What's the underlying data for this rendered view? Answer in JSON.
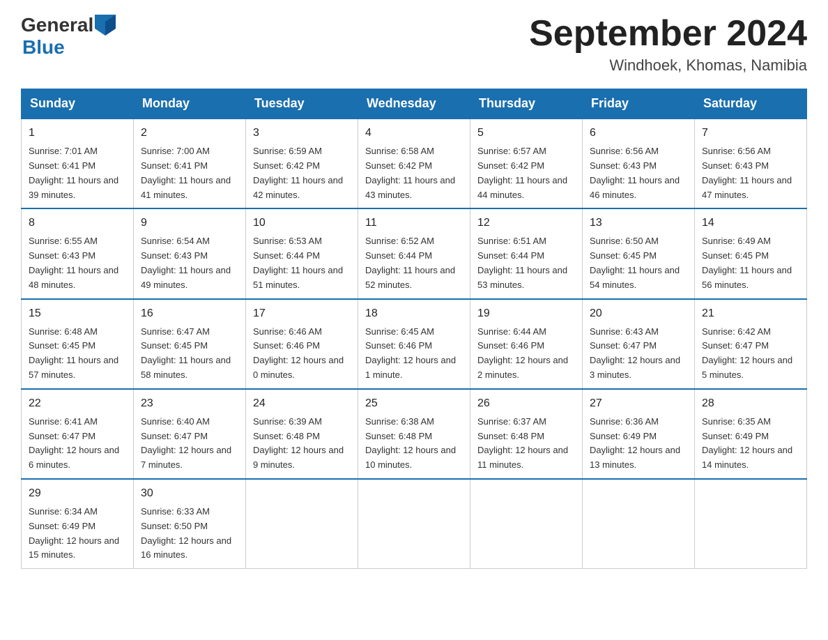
{
  "header": {
    "logo": {
      "general": "General",
      "blue": "Blue"
    },
    "title": "September 2024",
    "location": "Windhoek, Khomas, Namibia"
  },
  "days_of_week": [
    "Sunday",
    "Monday",
    "Tuesday",
    "Wednesday",
    "Thursday",
    "Friday",
    "Saturday"
  ],
  "weeks": [
    [
      {
        "day": "1",
        "sunrise": "Sunrise: 7:01 AM",
        "sunset": "Sunset: 6:41 PM",
        "daylight": "Daylight: 11 hours and 39 minutes."
      },
      {
        "day": "2",
        "sunrise": "Sunrise: 7:00 AM",
        "sunset": "Sunset: 6:41 PM",
        "daylight": "Daylight: 11 hours and 41 minutes."
      },
      {
        "day": "3",
        "sunrise": "Sunrise: 6:59 AM",
        "sunset": "Sunset: 6:42 PM",
        "daylight": "Daylight: 11 hours and 42 minutes."
      },
      {
        "day": "4",
        "sunrise": "Sunrise: 6:58 AM",
        "sunset": "Sunset: 6:42 PM",
        "daylight": "Daylight: 11 hours and 43 minutes."
      },
      {
        "day": "5",
        "sunrise": "Sunrise: 6:57 AM",
        "sunset": "Sunset: 6:42 PM",
        "daylight": "Daylight: 11 hours and 44 minutes."
      },
      {
        "day": "6",
        "sunrise": "Sunrise: 6:56 AM",
        "sunset": "Sunset: 6:43 PM",
        "daylight": "Daylight: 11 hours and 46 minutes."
      },
      {
        "day": "7",
        "sunrise": "Sunrise: 6:56 AM",
        "sunset": "Sunset: 6:43 PM",
        "daylight": "Daylight: 11 hours and 47 minutes."
      }
    ],
    [
      {
        "day": "8",
        "sunrise": "Sunrise: 6:55 AM",
        "sunset": "Sunset: 6:43 PM",
        "daylight": "Daylight: 11 hours and 48 minutes."
      },
      {
        "day": "9",
        "sunrise": "Sunrise: 6:54 AM",
        "sunset": "Sunset: 6:43 PM",
        "daylight": "Daylight: 11 hours and 49 minutes."
      },
      {
        "day": "10",
        "sunrise": "Sunrise: 6:53 AM",
        "sunset": "Sunset: 6:44 PM",
        "daylight": "Daylight: 11 hours and 51 minutes."
      },
      {
        "day": "11",
        "sunrise": "Sunrise: 6:52 AM",
        "sunset": "Sunset: 6:44 PM",
        "daylight": "Daylight: 11 hours and 52 minutes."
      },
      {
        "day": "12",
        "sunrise": "Sunrise: 6:51 AM",
        "sunset": "Sunset: 6:44 PM",
        "daylight": "Daylight: 11 hours and 53 minutes."
      },
      {
        "day": "13",
        "sunrise": "Sunrise: 6:50 AM",
        "sunset": "Sunset: 6:45 PM",
        "daylight": "Daylight: 11 hours and 54 minutes."
      },
      {
        "day": "14",
        "sunrise": "Sunrise: 6:49 AM",
        "sunset": "Sunset: 6:45 PM",
        "daylight": "Daylight: 11 hours and 56 minutes."
      }
    ],
    [
      {
        "day": "15",
        "sunrise": "Sunrise: 6:48 AM",
        "sunset": "Sunset: 6:45 PM",
        "daylight": "Daylight: 11 hours and 57 minutes."
      },
      {
        "day": "16",
        "sunrise": "Sunrise: 6:47 AM",
        "sunset": "Sunset: 6:45 PM",
        "daylight": "Daylight: 11 hours and 58 minutes."
      },
      {
        "day": "17",
        "sunrise": "Sunrise: 6:46 AM",
        "sunset": "Sunset: 6:46 PM",
        "daylight": "Daylight: 12 hours and 0 minutes."
      },
      {
        "day": "18",
        "sunrise": "Sunrise: 6:45 AM",
        "sunset": "Sunset: 6:46 PM",
        "daylight": "Daylight: 12 hours and 1 minute."
      },
      {
        "day": "19",
        "sunrise": "Sunrise: 6:44 AM",
        "sunset": "Sunset: 6:46 PM",
        "daylight": "Daylight: 12 hours and 2 minutes."
      },
      {
        "day": "20",
        "sunrise": "Sunrise: 6:43 AM",
        "sunset": "Sunset: 6:47 PM",
        "daylight": "Daylight: 12 hours and 3 minutes."
      },
      {
        "day": "21",
        "sunrise": "Sunrise: 6:42 AM",
        "sunset": "Sunset: 6:47 PM",
        "daylight": "Daylight: 12 hours and 5 minutes."
      }
    ],
    [
      {
        "day": "22",
        "sunrise": "Sunrise: 6:41 AM",
        "sunset": "Sunset: 6:47 PM",
        "daylight": "Daylight: 12 hours and 6 minutes."
      },
      {
        "day": "23",
        "sunrise": "Sunrise: 6:40 AM",
        "sunset": "Sunset: 6:47 PM",
        "daylight": "Daylight: 12 hours and 7 minutes."
      },
      {
        "day": "24",
        "sunrise": "Sunrise: 6:39 AM",
        "sunset": "Sunset: 6:48 PM",
        "daylight": "Daylight: 12 hours and 9 minutes."
      },
      {
        "day": "25",
        "sunrise": "Sunrise: 6:38 AM",
        "sunset": "Sunset: 6:48 PM",
        "daylight": "Daylight: 12 hours and 10 minutes."
      },
      {
        "day": "26",
        "sunrise": "Sunrise: 6:37 AM",
        "sunset": "Sunset: 6:48 PM",
        "daylight": "Daylight: 12 hours and 11 minutes."
      },
      {
        "day": "27",
        "sunrise": "Sunrise: 6:36 AM",
        "sunset": "Sunset: 6:49 PM",
        "daylight": "Daylight: 12 hours and 13 minutes."
      },
      {
        "day": "28",
        "sunrise": "Sunrise: 6:35 AM",
        "sunset": "Sunset: 6:49 PM",
        "daylight": "Daylight: 12 hours and 14 minutes."
      }
    ],
    [
      {
        "day": "29",
        "sunrise": "Sunrise: 6:34 AM",
        "sunset": "Sunset: 6:49 PM",
        "daylight": "Daylight: 12 hours and 15 minutes."
      },
      {
        "day": "30",
        "sunrise": "Sunrise: 6:33 AM",
        "sunset": "Sunset: 6:50 PM",
        "daylight": "Daylight: 12 hours and 16 minutes."
      },
      null,
      null,
      null,
      null,
      null
    ]
  ]
}
